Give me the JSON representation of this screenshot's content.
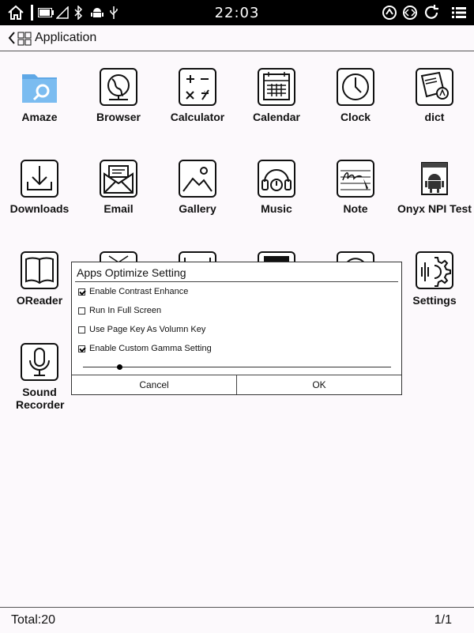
{
  "status_bar": {
    "time": "22:03",
    "icons_left": [
      "home-icon",
      "battery-icon",
      "signal-icon",
      "bluetooth-icon",
      "android-icon",
      "usb-icon"
    ],
    "icons_right": [
      "rotate-icon",
      "dual-arrow-icon",
      "refresh-icon",
      "menu-list-icon"
    ]
  },
  "header": {
    "title": "Application"
  },
  "apps": [
    {
      "label": "Amaze",
      "icon": "folder-search-icon"
    },
    {
      "label": "Browser",
      "icon": "globe-icon"
    },
    {
      "label": "Calculator",
      "icon": "calculator-icon"
    },
    {
      "label": "Calendar",
      "icon": "calendar-icon"
    },
    {
      "label": "Clock",
      "icon": "clock-icon"
    },
    {
      "label": "dict",
      "icon": "dictionary-icon"
    },
    {
      "label": "Downloads",
      "icon": "download-icon"
    },
    {
      "label": "Email",
      "icon": "email-icon"
    },
    {
      "label": "Gallery",
      "icon": "gallery-icon"
    },
    {
      "label": "Music",
      "icon": "headphones-icon"
    },
    {
      "label": "Note",
      "icon": "note-icon"
    },
    {
      "label": "Onyx NPI Test",
      "icon": "android-test-icon"
    },
    {
      "label": "OReader",
      "icon": "book-icon"
    },
    {
      "label": "Settings",
      "icon": "settings-icon"
    },
    {
      "label": "Sound Recorder",
      "icon": "microphone-icon"
    }
  ],
  "dialog": {
    "title": "Apps Optimize Setting",
    "options": [
      {
        "label": "Enable Contrast Enhance",
        "checked": true
      },
      {
        "label": "Run In Full Screen",
        "checked": false
      },
      {
        "label": "Use Page Key As Volumn Key",
        "checked": false
      },
      {
        "label": "Enable Custom Gamma Setting",
        "checked": true
      }
    ],
    "gamma_slider_level": 0.12,
    "cancel_label": "Cancel",
    "ok_label": "OK"
  },
  "footer": {
    "total": "Total:20",
    "page": "1/1"
  }
}
